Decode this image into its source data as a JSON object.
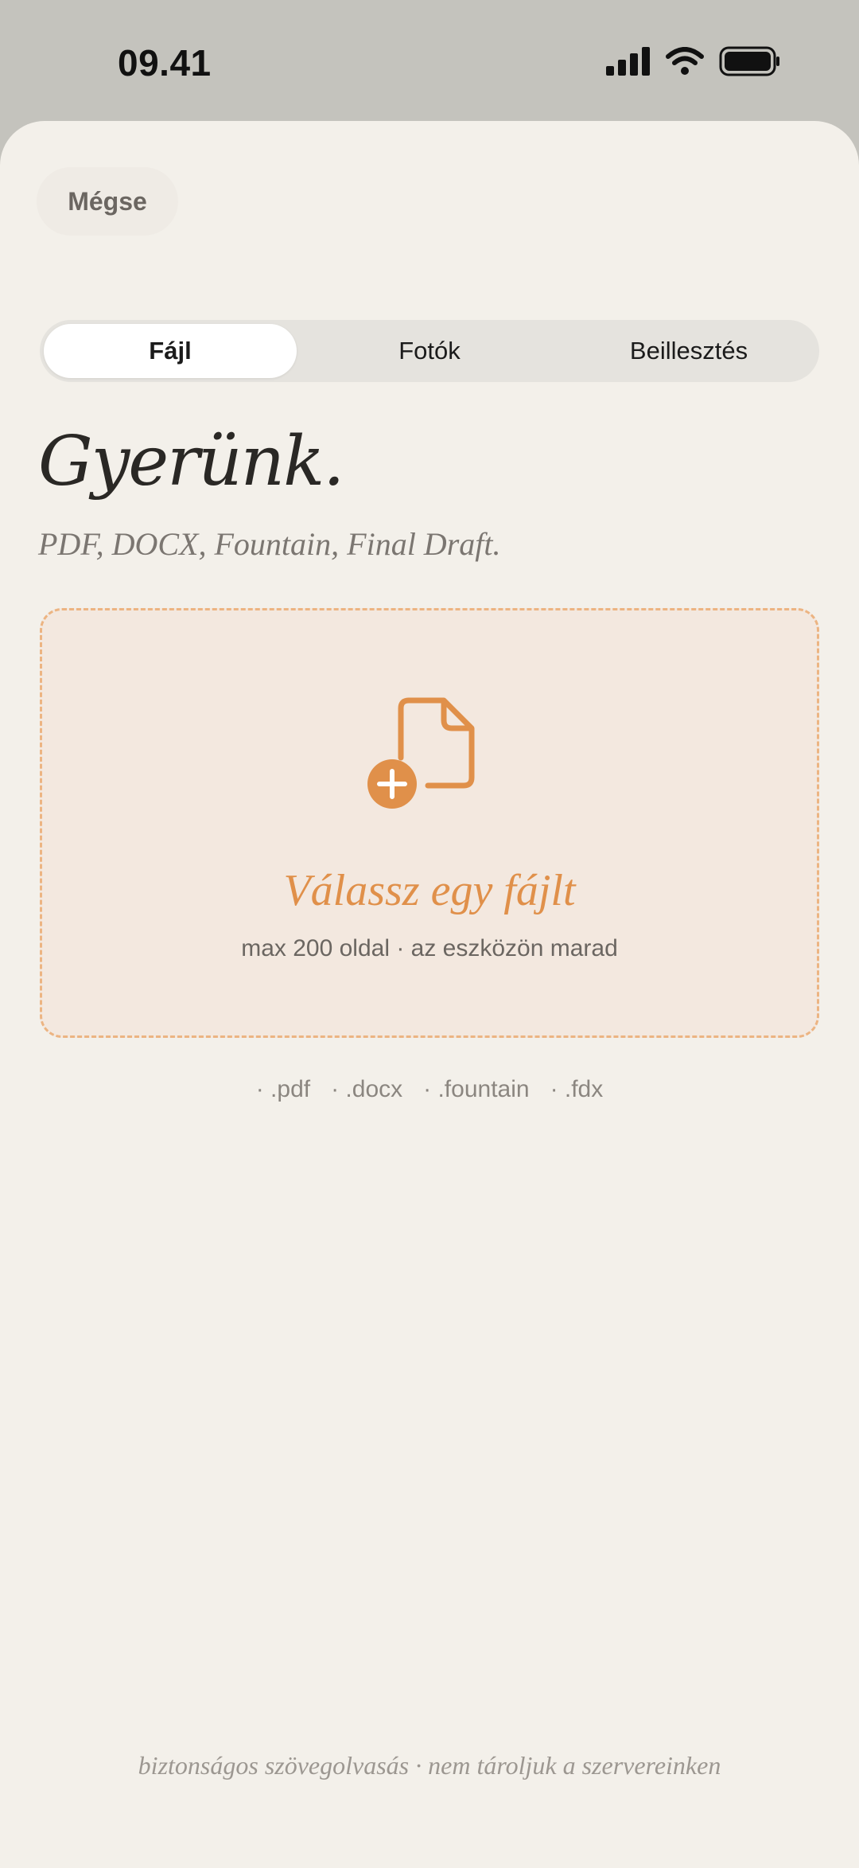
{
  "status_bar": {
    "time": "09.41"
  },
  "header": {
    "cancel_label": "Mégse"
  },
  "tabs": [
    {
      "label": "Fájl",
      "active": true
    },
    {
      "label": "Fotók",
      "active": false
    },
    {
      "label": "Beillesztés",
      "active": false
    }
  ],
  "main": {
    "title": "Gyerünk.",
    "subtitle": "PDF, DOCX, Fountain, Final Draft."
  },
  "dropzone": {
    "icon": "file-add-icon",
    "title": "Válassz egy fájlt",
    "subtitle": "max 200 oldal · az eszközön marad"
  },
  "formats": [
    "· .pdf",
    "· .docx",
    "· .fountain",
    "· .fdx"
  ],
  "footer": {
    "note": "biztonságos szövegolvasás · nem tároljuk a szervereinken"
  },
  "colors": {
    "accent": "#e0904a",
    "background": "#f3f0ea",
    "dropzone_bg": "#f3e8df",
    "dropzone_border": "#ecb482"
  }
}
